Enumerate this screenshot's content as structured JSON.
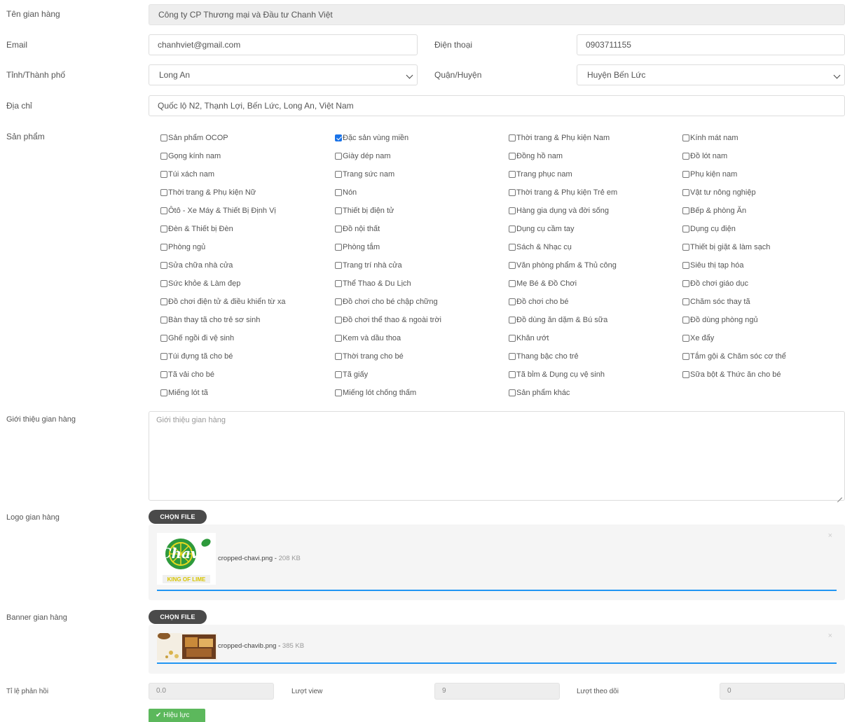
{
  "fields": {
    "store_name_label": "Tên gian hàng",
    "store_name_value": "Công ty CP Thương mại và Đầu tư Chanh Việt",
    "email_label": "Email",
    "email_value": "chanhviet@gmail.com",
    "phone_label": "Điện thoại",
    "phone_value": "0903711155",
    "province_label": "Tỉnh/Thành phố",
    "province_value": "Long An",
    "district_label": "Quận/Huyện",
    "district_value": "Huyện Bến Lức",
    "address_label": "Địa chỉ",
    "address_value": "Quốc lộ N2, Thạnh Lợi, Bến Lức, Long An, Việt Nam",
    "products_label": "Sản phẩm",
    "intro_label": "Giới thiệu gian hàng",
    "intro_placeholder": "Giới thiệu gian hàng",
    "logo_label": "Logo gian hàng",
    "banner_label": "Banner gian hàng",
    "choose_file_label": "CHỌN FILE",
    "response_rate_label": "Tỉ lệ phản hồi",
    "response_rate_value": "0.0",
    "views_label": "Lượt view",
    "views_value": "9",
    "followers_label": "Lượt theo dõi",
    "followers_value": "0",
    "submit_label": "Hiệu lực"
  },
  "products": [
    {
      "label": "Sản phẩm OCOP",
      "checked": false
    },
    {
      "label": "Đặc sản vùng miền",
      "checked": true
    },
    {
      "label": "Thời trang & Phụ kiện Nam",
      "checked": false
    },
    {
      "label": "Kính mát nam",
      "checked": false
    },
    {
      "label": "Gọng kính nam",
      "checked": false
    },
    {
      "label": "Giày dép nam",
      "checked": false
    },
    {
      "label": "Đồng hồ nam",
      "checked": false
    },
    {
      "label": "Đồ lót nam",
      "checked": false
    },
    {
      "label": "Túi xách nam",
      "checked": false
    },
    {
      "label": "Trang sức nam",
      "checked": false
    },
    {
      "label": "Trang phục nam",
      "checked": false
    },
    {
      "label": "Phụ kiện nam",
      "checked": false
    },
    {
      "label": "Thời trang & Phụ kiện Nữ",
      "checked": false
    },
    {
      "label": "Nón",
      "checked": false
    },
    {
      "label": "Thời trang & Phụ kiện Trẻ em",
      "checked": false
    },
    {
      "label": "Vật tư nông nghiệp",
      "checked": false
    },
    {
      "label": "Ôtô - Xe Máy & Thiết Bị Định Vị",
      "checked": false
    },
    {
      "label": "Thiết bị điện tử",
      "checked": false
    },
    {
      "label": "Hàng gia dụng và đời sống",
      "checked": false
    },
    {
      "label": "Bếp & phòng Ăn",
      "checked": false
    },
    {
      "label": "Đèn & Thiết bị Đèn",
      "checked": false
    },
    {
      "label": "Đồ nội thất",
      "checked": false
    },
    {
      "label": "Dụng cụ cầm tay",
      "checked": false
    },
    {
      "label": "Dụng cụ điện",
      "checked": false
    },
    {
      "label": "Phòng ngủ",
      "checked": false
    },
    {
      "label": "Phòng tắm",
      "checked": false
    },
    {
      "label": "Sách & Nhạc cụ",
      "checked": false
    },
    {
      "label": "Thiết bị giặt & làm sạch",
      "checked": false
    },
    {
      "label": "Sửa chữa nhà cửa",
      "checked": false
    },
    {
      "label": "Trang trí nhà cửa",
      "checked": false
    },
    {
      "label": "Văn phòng phẩm & Thủ công",
      "checked": false
    },
    {
      "label": "Siêu thị tạp hóa",
      "checked": false
    },
    {
      "label": "Sức khỏe & Làm đẹp",
      "checked": false
    },
    {
      "label": "Thể Thao & Du Lịch",
      "checked": false
    },
    {
      "label": "Mẹ Bé & Đồ Chơi",
      "checked": false
    },
    {
      "label": "Đồ chơi giáo dục",
      "checked": false
    },
    {
      "label": "Đồ chơi điện tử & điều khiển từ xa",
      "checked": false
    },
    {
      "label": "Đồ chơi cho bé chập chững",
      "checked": false
    },
    {
      "label": "Đồ chơi cho bé",
      "checked": false
    },
    {
      "label": "Chăm sóc thay tã",
      "checked": false
    },
    {
      "label": "Bàn thay tã cho trẻ sơ sinh",
      "checked": false
    },
    {
      "label": "Đồ chơi thể thao & ngoài trời",
      "checked": false
    },
    {
      "label": "Đồ dùng ăn dặm & Bú sữa",
      "checked": false
    },
    {
      "label": "Đồ dùng phòng ngủ",
      "checked": false
    },
    {
      "label": "Ghế ngồi đi vệ sinh",
      "checked": false
    },
    {
      "label": "Kem và dầu thoa",
      "checked": false
    },
    {
      "label": "Khăn ướt",
      "checked": false
    },
    {
      "label": "Xe đẩy",
      "checked": false
    },
    {
      "label": "Túi đựng tã cho bé",
      "checked": false
    },
    {
      "label": "Thời trang cho bé",
      "checked": false
    },
    {
      "label": "Thang bậc cho trẻ",
      "checked": false
    },
    {
      "label": "Tắm gội & Chăm sóc cơ thể",
      "checked": false
    },
    {
      "label": "Tã vải cho bé",
      "checked": false
    },
    {
      "label": "Tã giấy",
      "checked": false
    },
    {
      "label": "Tã bỉm & Dụng cụ vệ sinh",
      "checked": false
    },
    {
      "label": "Sữa bột & Thức ăn cho bé",
      "checked": false
    },
    {
      "label": "Miếng lót tã",
      "checked": false
    },
    {
      "label": "Miếng lót chống thấm",
      "checked": false
    },
    {
      "label": "Sản phẩm khác",
      "checked": false
    }
  ],
  "logo_upload": {
    "file_name": "cropped-chavi.png",
    "file_size": "208 KB",
    "logo_text": "Chavi",
    "logo_tagline": "KING OF LIME",
    "progress": 1.0
  },
  "banner_upload": {
    "file_name": "cropped-chavib.png",
    "file_size": "385 KB",
    "progress": 1.0
  },
  "icons": {
    "close": "×",
    "check": "✔"
  },
  "colors": {
    "accent": "#2196f3",
    "success": "#5cb85c",
    "checkbox": "#1a73e8",
    "logo_green": "#2e9a3c",
    "logo_yellow": "#e8d820"
  }
}
